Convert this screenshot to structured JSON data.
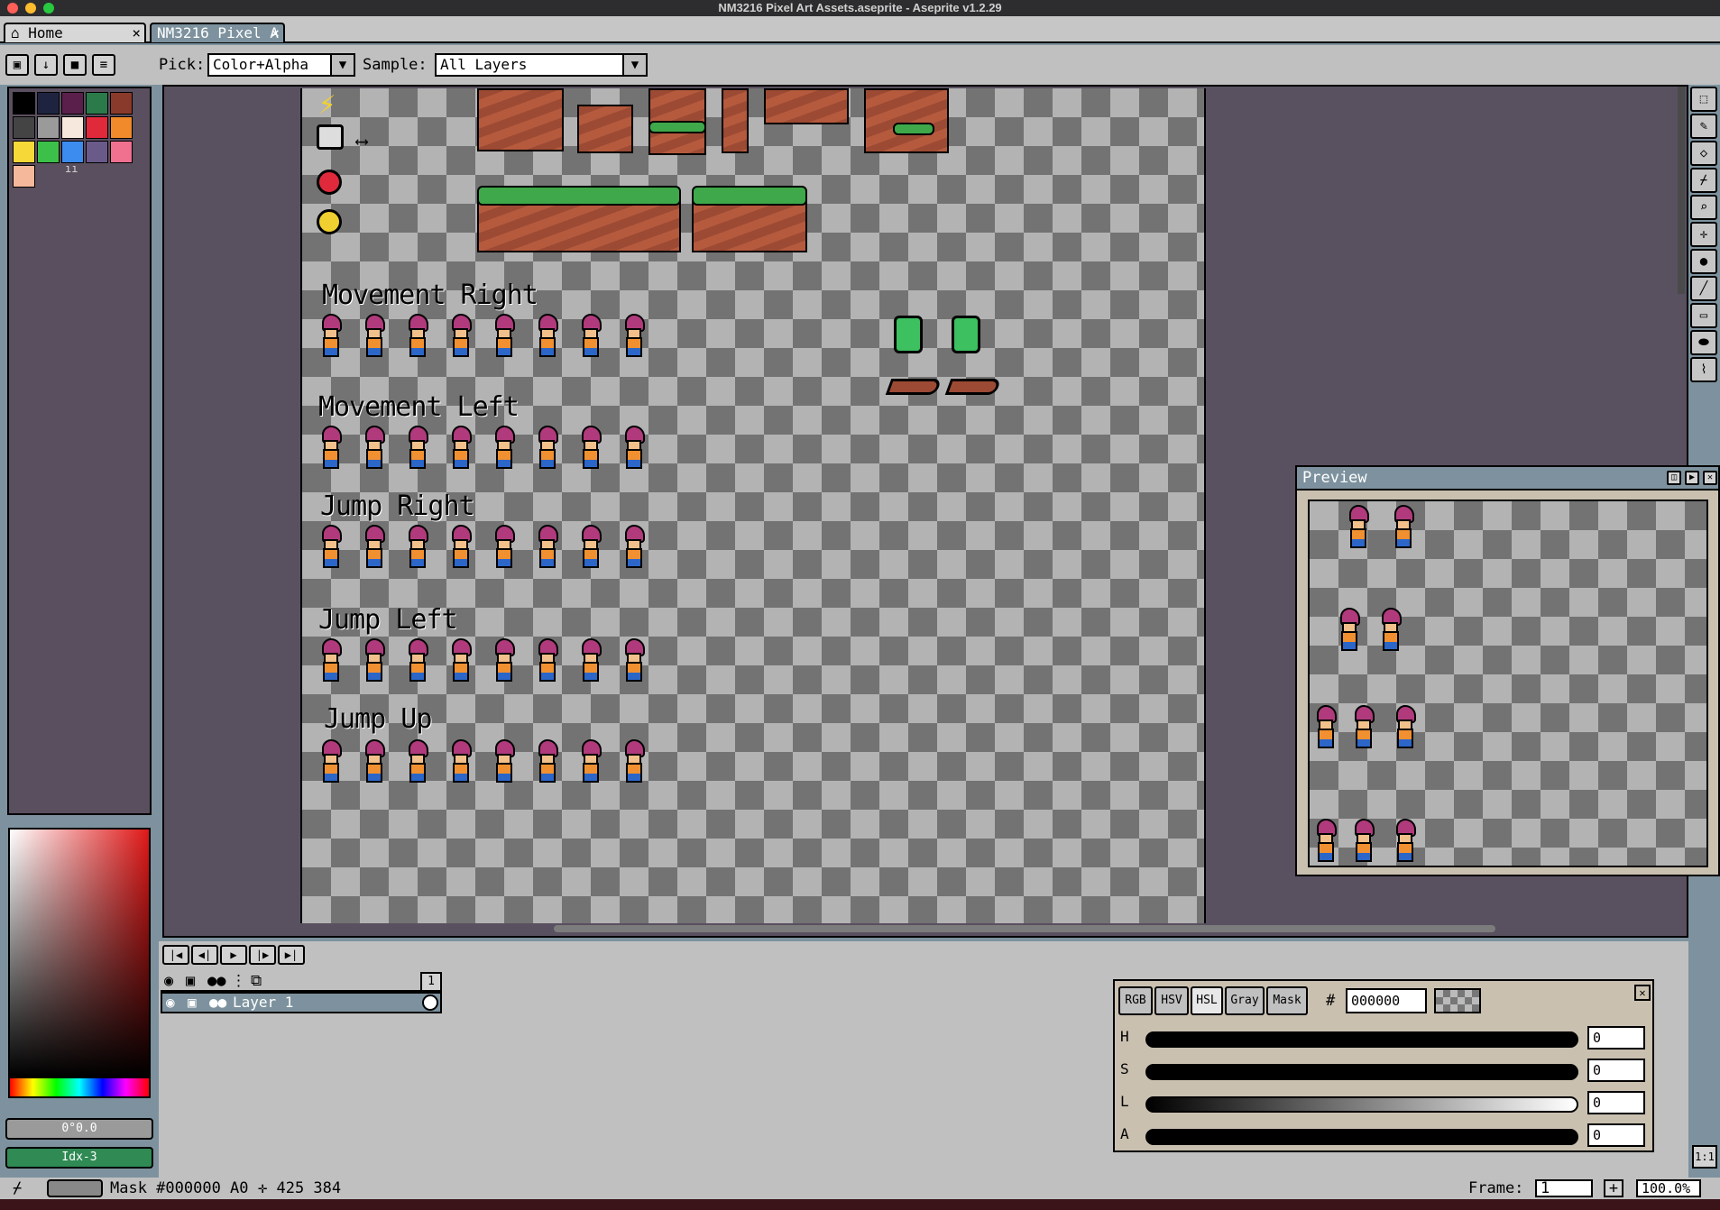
{
  "window": {
    "title": "NM3216 Pixel Art Assets.aseprite - Aseprite v1.2.29"
  },
  "tabs": [
    {
      "label": "Home",
      "close": "×"
    },
    {
      "label": "NM3216 Pixel A",
      "close": "×"
    }
  ],
  "context_bar": {
    "pick_label": "Pick:",
    "pick_value": "Color+Alpha",
    "sample_label": "Sample:",
    "sample_value": "All Layers"
  },
  "palette": {
    "colors": [
      "#000000",
      "#1e2440",
      "#5a1f4a",
      "#2a7a4a",
      "#8a3a2a",
      "#444444",
      "#9a9a9a",
      "#f6e8dc",
      "#e02a3c",
      "#f08a2a",
      "#f6d838",
      "#3cc04a",
      "#3c8cf0",
      "#6a5a8a",
      "#f07090",
      "#f6b89a"
    ],
    "extra": "ıı"
  },
  "color_bars": {
    "alpha_label": "0°0.0",
    "index_label": "Idx-3"
  },
  "canvas": {
    "rows": [
      {
        "title": "Movement Right"
      },
      {
        "title": "Movement Left"
      },
      {
        "title": "Jump Right"
      },
      {
        "title": "Jump Left"
      },
      {
        "title": "Jump Up"
      }
    ]
  },
  "preview": {
    "title": "Preview"
  },
  "timeline": {
    "buttons": [
      "|◀",
      "◀|",
      "▶",
      "|▶",
      "▶|"
    ],
    "layer_name": "Layer 1",
    "frame_number": "1"
  },
  "color_selector": {
    "modes": [
      "RGB",
      "HSV",
      "HSL",
      "Gray",
      "Mask"
    ],
    "active_mode": "HSL",
    "hash": "#",
    "hex_value": "000000",
    "sliders": [
      {
        "label": "H",
        "value": "0"
      },
      {
        "label": "S",
        "value": "0"
      },
      {
        "label": "L",
        "value": "0"
      },
      {
        "label": "A",
        "value": "0"
      }
    ]
  },
  "status": {
    "mask_text": "Mask #000000 A0",
    "coords": "✛ 425 384",
    "frame_label": "Frame:",
    "frame_value": "1",
    "zoom_value": "100.0%",
    "fit_label": "1:1"
  }
}
